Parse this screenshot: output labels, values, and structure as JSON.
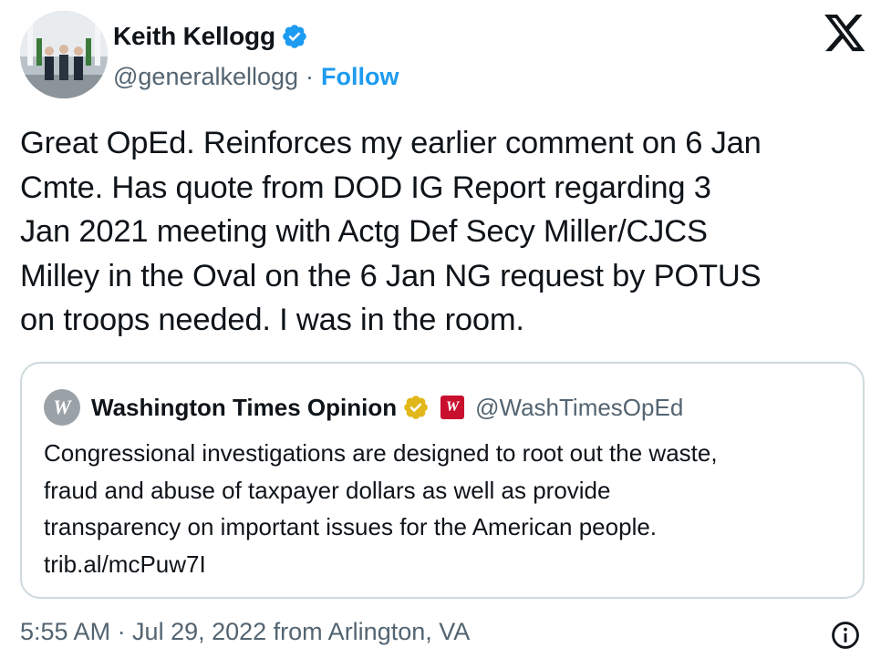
{
  "author": {
    "name": "Keith Kellogg",
    "handle": "@generalkellogg",
    "separator": "·",
    "follow_label": "Follow"
  },
  "tweet": {
    "lines": [
      "Great OpEd. Reinforces my earlier comment on 6 Jan",
      "Cmte. Has quote from DOD IG Report regarding  3",
      "Jan 2021 meeting with Actg Def Secy Miller/CJCS",
      "Milley in the Oval on the 6 Jan NG request by POTUS",
      "on troops needed. I was in the room."
    ]
  },
  "quote": {
    "avatar_text": "W",
    "name": "Washington Times Opinion",
    "affiliate_text": "W",
    "handle": "@WashTimesOpEd",
    "lines": [
      "Congressional investigations are designed to root out the waste,",
      "fraud and abuse of taxpayer dollars as well as provide",
      "transparency on important issues for the American people.",
      "trib.al/mcPuw7I"
    ]
  },
  "footer": {
    "timestamp": "5:55 AM · Jul 29, 2022 from Arlington, VA"
  },
  "colors": {
    "accent": "#1d9bf0",
    "gold_badge": "#e2b719",
    "affiliate_red": "#c8102e",
    "secondary_text": "#536471",
    "border": "#cfd9de"
  },
  "icons": [
    "verified-badge-icon",
    "x-logo-icon",
    "gold-verified-badge-icon",
    "info-icon"
  ]
}
